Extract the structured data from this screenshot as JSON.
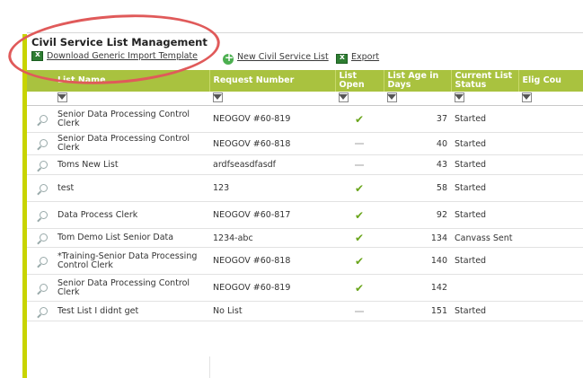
{
  "header": {
    "title": "Civil Service List Management",
    "download_label": "Download Generic Import Template",
    "new_list_label": "New Civil Service List",
    "export_label": "Export"
  },
  "columns": [
    "List Name",
    "Request Number",
    "List Open",
    "List Age in Days",
    "Current List Status",
    "Elig Cou"
  ],
  "rows": [
    {
      "name": "Senior Data Processing Control Clerk",
      "request": "NEOGOV #60-819",
      "open": true,
      "age": "37",
      "status": "Started"
    },
    {
      "name": "Senior Data Processing Control Clerk",
      "request": "NEOGOV #60-818",
      "open": false,
      "age": "40",
      "status": "Started"
    },
    {
      "name": "Toms New List",
      "request": "ardfseasdfasdf",
      "open": false,
      "age": "43",
      "status": "Started"
    },
    {
      "name": "test",
      "request": "123",
      "open": true,
      "age": "58",
      "status": "Started"
    },
    {
      "name": "Data Process Clerk",
      "request": "NEOGOV #60-817",
      "open": true,
      "age": "92",
      "status": "Started"
    },
    {
      "name": "Tom Demo List Senior Data",
      "request": "1234-abc",
      "open": true,
      "age": "134",
      "status": "Canvass Sent"
    },
    {
      "name": "*Training-Senior Data Processing Control Clerk",
      "request": "NEOGOV #60-818",
      "open": true,
      "age": "140",
      "status": "Started"
    },
    {
      "name": "Senior Data Processing Control Clerk",
      "request": "NEOGOV #60-819",
      "open": true,
      "age": "142",
      "status": ""
    },
    {
      "name": "Test List I didnt get",
      "request": "No List",
      "open": false,
      "age": "151",
      "status": "Started"
    }
  ],
  "colors": {
    "accent": "#a9c23f",
    "sidebar": "#c8d400",
    "highlight_oval": "#e05a5a",
    "check": "#6aa51c"
  }
}
